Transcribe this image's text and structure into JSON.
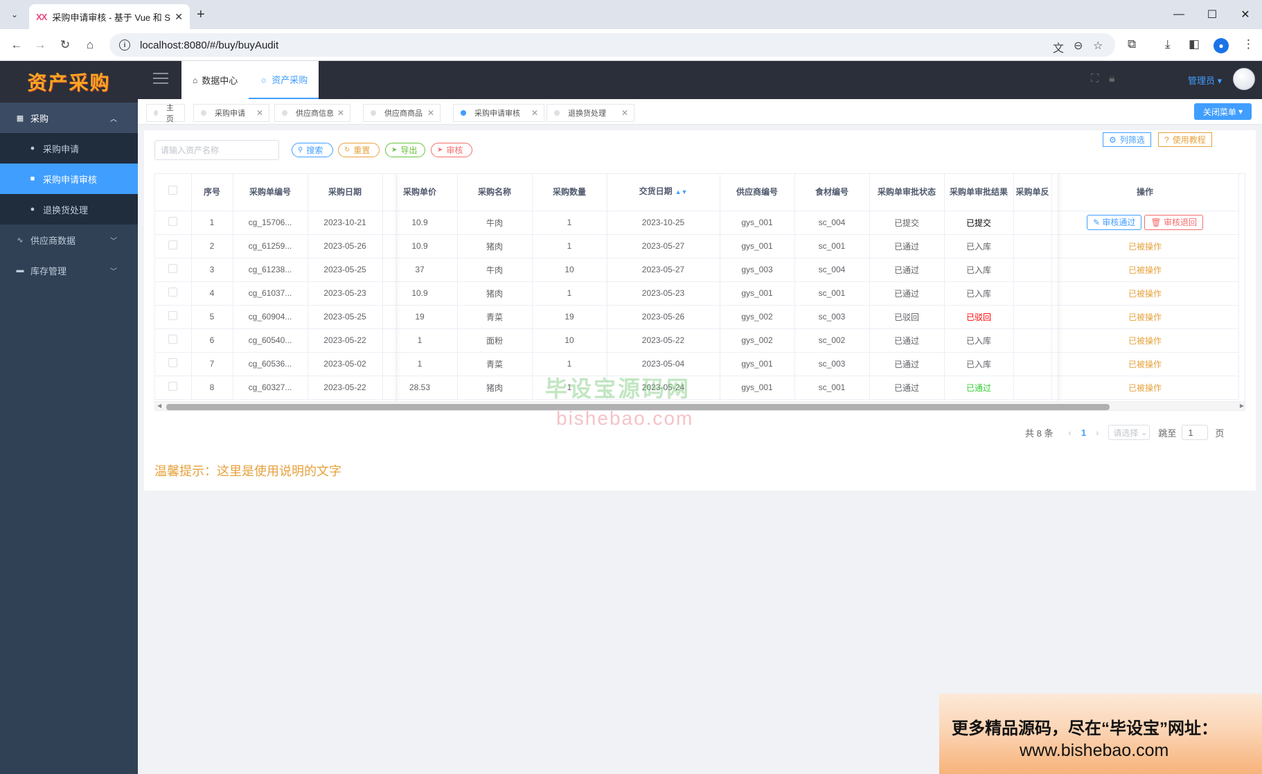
{
  "browser": {
    "tab_icon": "XX",
    "tab_title": "采购申请审核 - 基于 Vue 和 Sp",
    "url": "localhost:8080/#/buy/buyAudit"
  },
  "app": {
    "logo": "资产采购",
    "menu": {
      "purchase": "采购",
      "purchase_apply": "采购申请",
      "purchase_audit": "采购申请审核",
      "return_handle": "退换货处理",
      "supplier_data": "供应商数据",
      "inventory": "库存管理"
    },
    "topnav": {
      "data_center": "数据中心",
      "asset_purchase": "资产采购"
    },
    "admin": "管理员",
    "tags": [
      "主页",
      "采购申请",
      "供应商信息",
      "供应商商品",
      "采购申请审核",
      "退换货处理"
    ],
    "close_menu": "关闭菜单"
  },
  "toolbar": {
    "search_placeholder": "请输入资产名称",
    "search": "搜索",
    "reset": "重置",
    "export": "导出",
    "audit": "审核",
    "column_filter": "列筛选",
    "tutorial": "使用教程"
  },
  "table": {
    "headers": [
      "序号",
      "采购单编号",
      "采购日期",
      "采购单价",
      "采购名称",
      "采购数量",
      "交货日期",
      "供应商编号",
      "食材编号",
      "采购单审批状态",
      "采购单审批结果",
      "采购单反",
      "操作"
    ],
    "rows": [
      [
        "1",
        "cg_15706...",
        "2023-10-21",
        "10.9",
        "牛肉",
        "1",
        "2023-10-25",
        "gys_001",
        "sc_004",
        "已提交",
        "已提交"
      ],
      [
        "2",
        "cg_61259...",
        "2023-05-26",
        "10.9",
        "猪肉",
        "1",
        "2023-05-27",
        "gys_001",
        "sc_001",
        "已通过",
        "已入库"
      ],
      [
        "3",
        "cg_61238...",
        "2023-05-25",
        "37",
        "牛肉",
        "10",
        "2023-05-27",
        "gys_003",
        "sc_004",
        "已通过",
        "已入库"
      ],
      [
        "4",
        "cg_61037...",
        "2023-05-23",
        "10.9",
        "猪肉",
        "1",
        "2023-05-23",
        "gys_001",
        "sc_001",
        "已通过",
        "已入库"
      ],
      [
        "5",
        "cg_60904...",
        "2023-05-25",
        "19",
        "青菜",
        "19",
        "2023-05-26",
        "gys_002",
        "sc_003",
        "已驳回",
        "已驳回"
      ],
      [
        "6",
        "cg_60540...",
        "2023-05-22",
        "1",
        "面粉",
        "10",
        "2023-05-22",
        "gys_002",
        "sc_002",
        "已通过",
        "已入库"
      ],
      [
        "7",
        "cg_60536...",
        "2023-05-02",
        "1",
        "青菜",
        "1",
        "2023-05-04",
        "gys_001",
        "sc_003",
        "已通过",
        "已入库"
      ],
      [
        "8",
        "cg_60327...",
        "2023-05-22",
        "28.53",
        "猪肉",
        "1",
        "2023-05-24",
        "gys_001",
        "sc_001",
        "已通过",
        "已通过"
      ]
    ],
    "result_colors": [
      "#000000",
      "#606266",
      "#606266",
      "#606266",
      "#ff0000",
      "#606266",
      "#606266",
      "#33cc33"
    ],
    "op_pass": "审核通过",
    "op_back": "审核退回",
    "op_done": "已被操作"
  },
  "pager": {
    "total": "共 8 条",
    "page": "1",
    "size_placeholder": "请选择",
    "goto": "跳至",
    "goto_value": "1",
    "page_unit": "页"
  },
  "tip": "温馨提示：这里是使用说明的文字",
  "watermark": {
    "line1": "毕设宝源码网",
    "line2": "bishebao.com"
  },
  "ad": {
    "line1": "更多精品源码，尽在“毕设宝”网址：",
    "line2": "www.bishebao.com"
  }
}
